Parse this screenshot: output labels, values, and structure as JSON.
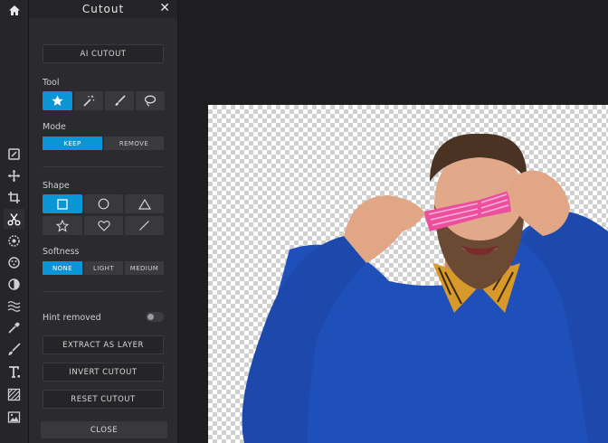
{
  "panel": {
    "title": "Cutout",
    "ai_cutout": "AI CUTOUT",
    "tool_label": "Tool",
    "mode_label": "Mode",
    "mode_options": [
      "KEEP",
      "REMOVE"
    ],
    "mode_selected": "KEEP",
    "shape_label": "Shape",
    "softness_label": "Softness",
    "softness_options": [
      "NONE",
      "LIGHT",
      "MEDIUM"
    ],
    "softness_selected": "NONE",
    "hint_label": "Hint removed",
    "hint_enabled": false,
    "extract_layer": "EXTRACT AS LAYER",
    "invert_cutout": "INVERT CUTOUT",
    "reset_cutout": "RESET CUTOUT",
    "close": "CLOSE"
  },
  "tools": [
    "star-brush-icon",
    "magic-wand-icon",
    "brush-icon",
    "lasso-icon"
  ],
  "tool_selected": "star-brush-icon",
  "shapes": [
    "rectangle-icon",
    "circle-icon",
    "triangle-icon",
    "star-icon",
    "heart-icon",
    "line-icon"
  ],
  "shape_selected": "rectangle-icon",
  "rail_tools": [
    "home-icon",
    "adjust-icon",
    "move-icon",
    "crop-icon",
    "cutout-scissors-icon",
    "filter-icon",
    "effects-icon",
    "tone-icon",
    "liquify-icon",
    "eyedropper-icon",
    "brush-icon",
    "text-icon",
    "pattern-icon",
    "image-icon"
  ],
  "rail_selected": "cutout-scissors-icon",
  "colors": {
    "accent": "#0a95d6",
    "panel": "#2b2b2f",
    "rail": "#26262a",
    "background": "#1e1e21",
    "sweater": "#1f4fb8",
    "glasses": "#ec4f9e"
  }
}
